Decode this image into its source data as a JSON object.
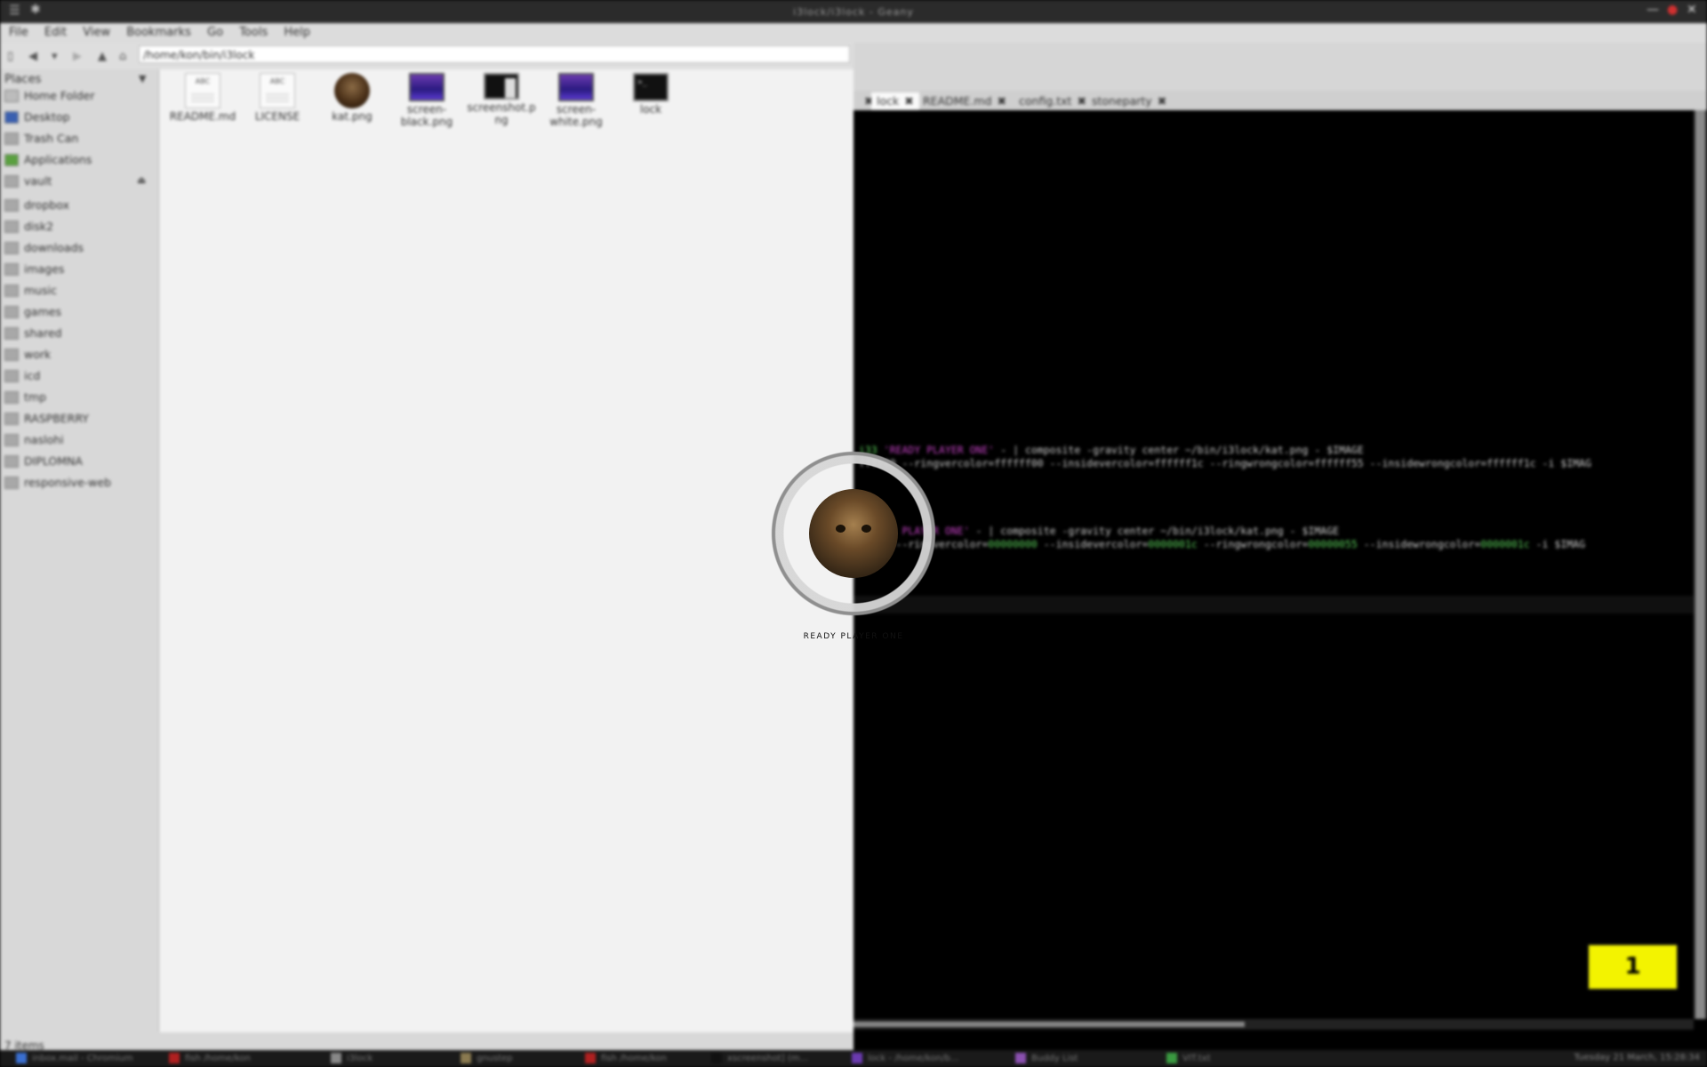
{
  "window": {
    "title": "i3lock/i3lock - Geany"
  },
  "menubar": {
    "items": [
      "File",
      "Edit",
      "View",
      "Bookmarks",
      "Go",
      "Tools",
      "Help"
    ]
  },
  "location": {
    "path": "/home/kon/bin/i3lock"
  },
  "sidebar": {
    "header": "Places",
    "items": [
      {
        "label": "Home Folder",
        "icon": "home-icon"
      },
      {
        "label": "Desktop",
        "icon": "desktop-icon"
      },
      {
        "label": "Trash Can",
        "icon": "trash-icon"
      },
      {
        "label": "Applications",
        "icon": "applications-icon"
      },
      {
        "label": "vault",
        "icon": "drive-icon"
      },
      {
        "label": "dropbox",
        "icon": "folder-icon"
      },
      {
        "label": "disk2",
        "icon": "folder-icon"
      },
      {
        "label": "downloads",
        "icon": "folder-icon"
      },
      {
        "label": "images",
        "icon": "folder-icon"
      },
      {
        "label": "music",
        "icon": "folder-icon"
      },
      {
        "label": "games",
        "icon": "folder-icon"
      },
      {
        "label": "shared",
        "icon": "folder-icon"
      },
      {
        "label": "work",
        "icon": "folder-icon"
      },
      {
        "label": "icd",
        "icon": "folder-icon"
      },
      {
        "label": "tmp",
        "icon": "folder-icon"
      },
      {
        "label": "RASPBERRY",
        "icon": "folder-icon"
      },
      {
        "label": "naslohi",
        "icon": "folder-icon"
      },
      {
        "label": "DIPLOMNA",
        "icon": "folder-icon"
      },
      {
        "label": "responsive-web",
        "icon": "folder-icon"
      }
    ]
  },
  "files": [
    {
      "name": "README.md",
      "line2": "",
      "type": "doc"
    },
    {
      "name": "LICENSE",
      "line2": "",
      "type": "doc"
    },
    {
      "name": "kat.png",
      "line2": "",
      "type": "cat"
    },
    {
      "name": "screen-",
      "line2": "black.png",
      "type": "purple"
    },
    {
      "name": "screenshot.p",
      "line2": "ng",
      "type": "black"
    },
    {
      "name": "screen-",
      "line2": "white.png",
      "type": "purple"
    },
    {
      "name": "lock",
      "line2": "",
      "type": "term"
    }
  ],
  "status": {
    "text": "7 items"
  },
  "editor_tabs": [
    "lock",
    "README.md",
    "config.txt",
    "stoneparty"
  ],
  "doc_icon_text": "ABC",
  "terminal": {
    "l1a": "i33 ",
    "l1b": "'READY PLAYER ONE'",
    "l1c": " - | composite -gravity center ~/bin/i3lock/kat.png - $IMAGE",
    "l2": "ffff00 --ringvercolor=ffffff00 --insidevercolor=ffffff1c --ringwrongcolor=ffffff55 --insidewrongcolor=ffffff1c  -i $IMAG",
    "l3a": "   ",
    "l3b": "'READY PLAYER ONE'",
    "l3c": " - | composite -gravity center ~/bin/i3lock/kat.png - $IMAGE",
    "l4a": "00000 --ringvercolor=",
    "l4b": "00000000",
    "l4c": " --insidevercolor=",
    "l4d": "0000001c",
    "l4e": " --ringwrongcolor=",
    "l4f": "00000055",
    "l4g": " --insidewrongcolor=",
    "l4h": "0000001c",
    "l4i": "  -i $IMAG"
  },
  "workspace": {
    "number": "1"
  },
  "lock_screen": {
    "label": "READY PLAYER ONE"
  },
  "taskbar": {
    "tasks": [
      "inbox.mail - Chromium",
      "fish /home/kon",
      "i3lock",
      "gnustep",
      "fish /home/kon",
      "xscreenshot] (m...",
      "lock - /home/kon/b...",
      "Buddy List",
      "VIT.txt"
    ],
    "clock": "Tuesday 21 March, 15:28:34"
  },
  "colors": {
    "badge": "#f3f300",
    "magenta": "#c040c0",
    "green": "#5ad05a"
  }
}
